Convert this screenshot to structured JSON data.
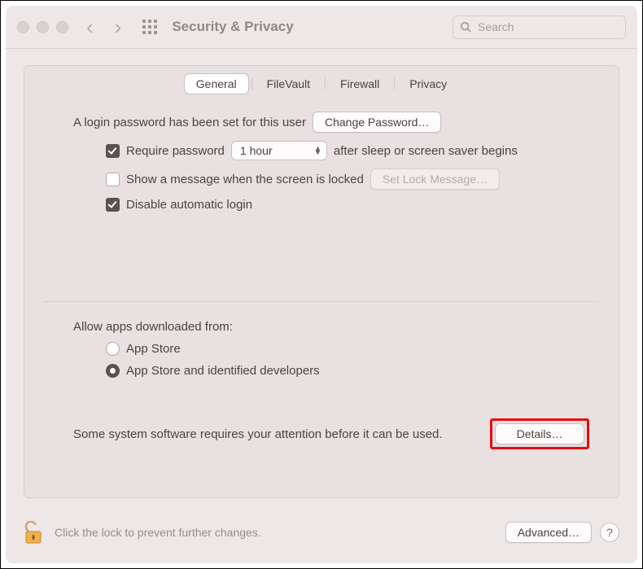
{
  "toolbar": {
    "title": "Security & Privacy",
    "search_placeholder": "Search"
  },
  "tabs": {
    "items": [
      "General",
      "FileVault",
      "Firewall",
      "Privacy"
    ],
    "selected": "General"
  },
  "general": {
    "login_password_text": "A login password has been set for this user",
    "change_password_btn": "Change Password…",
    "require_password": {
      "checked": true,
      "label_before": "Require password",
      "delay_value": "1 hour",
      "label_after": "after sleep or screen saver begins"
    },
    "show_message": {
      "checked": false,
      "label": "Show a message when the screen is locked",
      "button": "Set Lock Message…",
      "button_enabled": false
    },
    "disable_auto_login": {
      "checked": true,
      "label": "Disable automatic login"
    },
    "allow_apps": {
      "heading": "Allow apps downloaded from:",
      "options": [
        "App Store",
        "App Store and identified developers"
      ],
      "selected": "App Store and identified developers"
    },
    "attention": {
      "text": "Some system software requires your attention before it can be used.",
      "button": "Details…"
    }
  },
  "footer": {
    "lock_text": "Click the lock to prevent further changes.",
    "advanced_btn": "Advanced…",
    "help": "?"
  }
}
